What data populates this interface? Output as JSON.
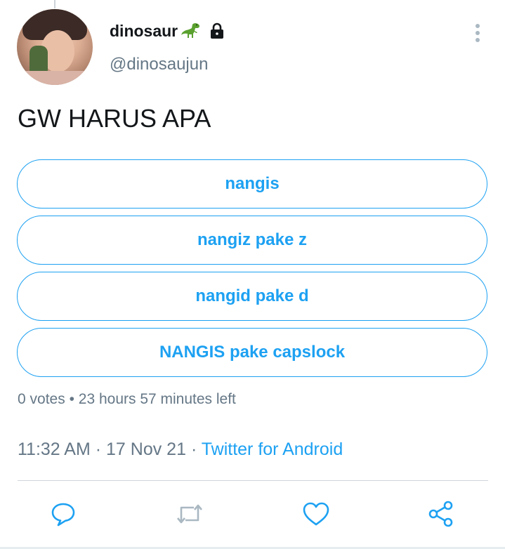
{
  "tweet": {
    "author": {
      "display_name": "dinosaur",
      "display_name_emoji": "dinosaur-emoji",
      "handle": "@dinosaujun",
      "protected": true,
      "avatar": "profile-photo"
    },
    "text": "GW HARUS APA",
    "poll": {
      "options": [
        {
          "label": "nangis"
        },
        {
          "label": "nangiz pake z"
        },
        {
          "label": "nangid pake d"
        },
        {
          "label": "NANGIS pake capslock"
        }
      ],
      "votes": "0 votes",
      "separator": "•",
      "time_left": "23 hours 57 minutes left"
    },
    "time": "11:32 AM",
    "date": "17 Nov 21",
    "separator": "·",
    "source": "Twitter for Android"
  },
  "actions": [
    {
      "icon": "reply-icon"
    },
    {
      "icon": "retweet-icon"
    },
    {
      "icon": "like-icon"
    },
    {
      "icon": "share-icon"
    }
  ],
  "colors": {
    "accent": "#1da1f2",
    "secondary_text": "#657786",
    "primary_text": "#14171a",
    "divider": "#cfd6dc"
  }
}
